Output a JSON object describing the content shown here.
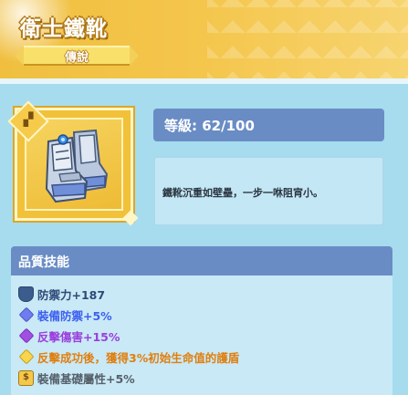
{
  "header": {
    "title": "衛士鐵靴",
    "rarity": "傳說"
  },
  "item": {
    "icon": "boots-icon",
    "level_text": "等級: 62/100",
    "description": "鐵靴沉重如壁壘，一步一咻阻宵小。"
  },
  "skills": {
    "title": "品質技能",
    "rows": [
      {
        "icon": "shield-icon",
        "text": "防禦力+187",
        "color": "#2e4a78"
      },
      {
        "icon": "blue-diamond-icon",
        "text": "裝備防禦+5%",
        "color": "#3d60f0"
      },
      {
        "icon": "purple-diamond-icon",
        "text": "反擊傷害+15%",
        "color": "#9a3fdc"
      },
      {
        "icon": "yellow-diamond-icon",
        "text": "反擊成功後，獲得3%初始生命值的護盾",
        "color": "#e07f0e"
      },
      {
        "icon": "coin-icon",
        "text": "裝備基礎屬性+5%",
        "color": "#55606a"
      }
    ]
  },
  "colors": {
    "header_gold": "#f4c64c",
    "panel_blue": "#6a8cc5",
    "background": "#a6dcee"
  }
}
